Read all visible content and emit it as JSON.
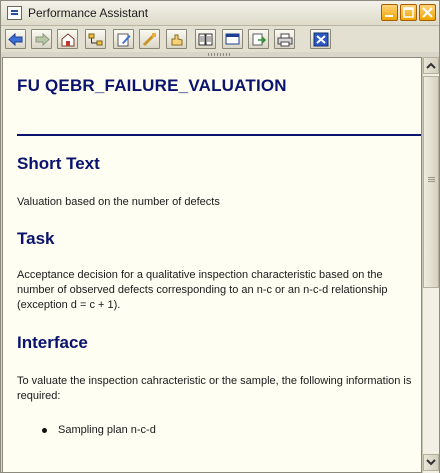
{
  "window": {
    "title": "Performance Assistant"
  },
  "toolbar": {
    "buttons": [
      {
        "name": "back-icon"
      },
      {
        "name": "forward-icon"
      },
      {
        "name": "home-icon"
      },
      {
        "name": "structure-icon"
      },
      {
        "name": "edit-icon"
      },
      {
        "name": "technical-info-icon"
      },
      {
        "name": "hand-icon"
      },
      {
        "name": "book-icon"
      },
      {
        "name": "window-icon"
      },
      {
        "name": "export-icon"
      },
      {
        "name": "print-icon"
      },
      {
        "name": "close-icon"
      }
    ]
  },
  "document": {
    "title": "FU QEBR_FAILURE_VALUATION",
    "sections": [
      {
        "heading": "Short Text",
        "paragraphs": [
          "Valuation based on the number of defects"
        ]
      },
      {
        "heading": "Task",
        "paragraphs": [
          "Acceptance decision for a qualitative inspection characteristic based on the number of observed defects corresponding to an n-c or an n-c-d relationship (exception d = c + 1)."
        ]
      },
      {
        "heading": "Interface",
        "paragraphs": [
          "To valuate the inspection cahracteristic or the sample, the following information is required:"
        ],
        "bullets": [
          "Sampling plan n-c-d"
        ]
      }
    ]
  },
  "colors": {
    "heading": "#0a136e",
    "background": "#fefef2",
    "window": "#d9d5c8"
  }
}
